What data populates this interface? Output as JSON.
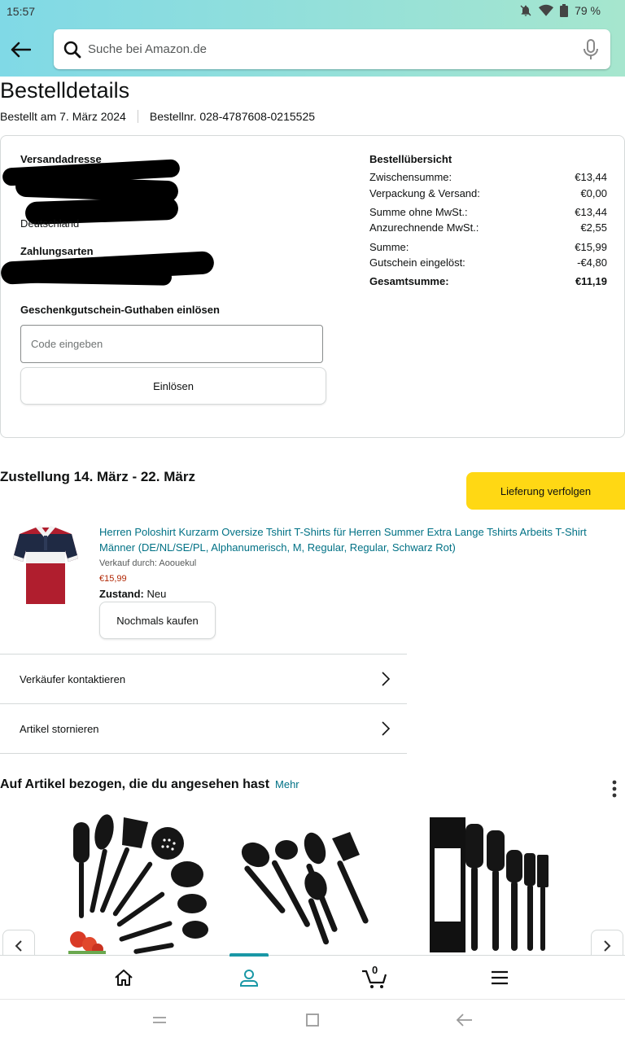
{
  "status_bar": {
    "time": "15:57",
    "battery": "79 %"
  },
  "search": {
    "placeholder": "Suche bei Amazon.de"
  },
  "page": {
    "title": "Bestelldetails",
    "order_date": "Bestellt am 7. März 2024",
    "order_number": "Bestellnr. 028-4787608-0215525"
  },
  "shipping": {
    "label": "Versandadresse",
    "country": "Deutschland"
  },
  "payment": {
    "label": "Zahlungsarten"
  },
  "gift_card": {
    "label": "Geschenkgutschein-Guthaben einlösen",
    "input_placeholder": "Code eingeben",
    "redeem_button": "Einlösen"
  },
  "summary": {
    "title": "Bestellübersicht",
    "rows": [
      {
        "label": "Zwischensumme:",
        "value": "€13,44"
      },
      {
        "label": "Verpackung & Versand:",
        "value": "€0,00"
      },
      {
        "label": "Summe ohne MwSt.:",
        "value": "€13,44"
      },
      {
        "label": "Anzurechnende MwSt.:",
        "value": "€2,55"
      },
      {
        "label": "Summe:",
        "value": "€15,99"
      },
      {
        "label": "Gutschein eingelöst:",
        "value": "-€4,80"
      },
      {
        "label": "Gesamtsumme:",
        "value": "€11,19"
      }
    ]
  },
  "delivery": {
    "title": "Zustellung 14. März - 22. März",
    "track_button": "Lieferung verfolgen"
  },
  "product": {
    "title": "Herren Poloshirt Kurzarm Oversize Tshirt T-Shirts für Herren Summer Extra Lange Tshirts Arbeits T-Shirt Männer (DE/NL/SE/PL, Alphanumerisch, M, Regular, Regular, Schwarz Rot)",
    "seller": "Verkauf durch: Aoouekul",
    "price": "€15,99",
    "condition_label": "Zustand:",
    "condition_value": "Neu",
    "buy_again_button": "Nochmals kaufen"
  },
  "actions": [
    {
      "label": "Verkäufer kontaktieren"
    },
    {
      "label": "Artikel stornieren"
    }
  ],
  "recommendations": {
    "title": "Auf Artikel bezogen, die du angesehen hast",
    "more_link": "Mehr"
  },
  "bottom_nav": {
    "cart_count": "0"
  },
  "colors": {
    "accent": "#1a98a6",
    "link": "#007185",
    "price": "#b12704",
    "track_button": "#ffd814"
  },
  "icons": [
    "arrow-left-icon",
    "search-icon",
    "microphone-icon",
    "chevron-right-icon",
    "more-vert-icon",
    "home-icon",
    "account-icon",
    "cart-icon",
    "menu-icon"
  ]
}
